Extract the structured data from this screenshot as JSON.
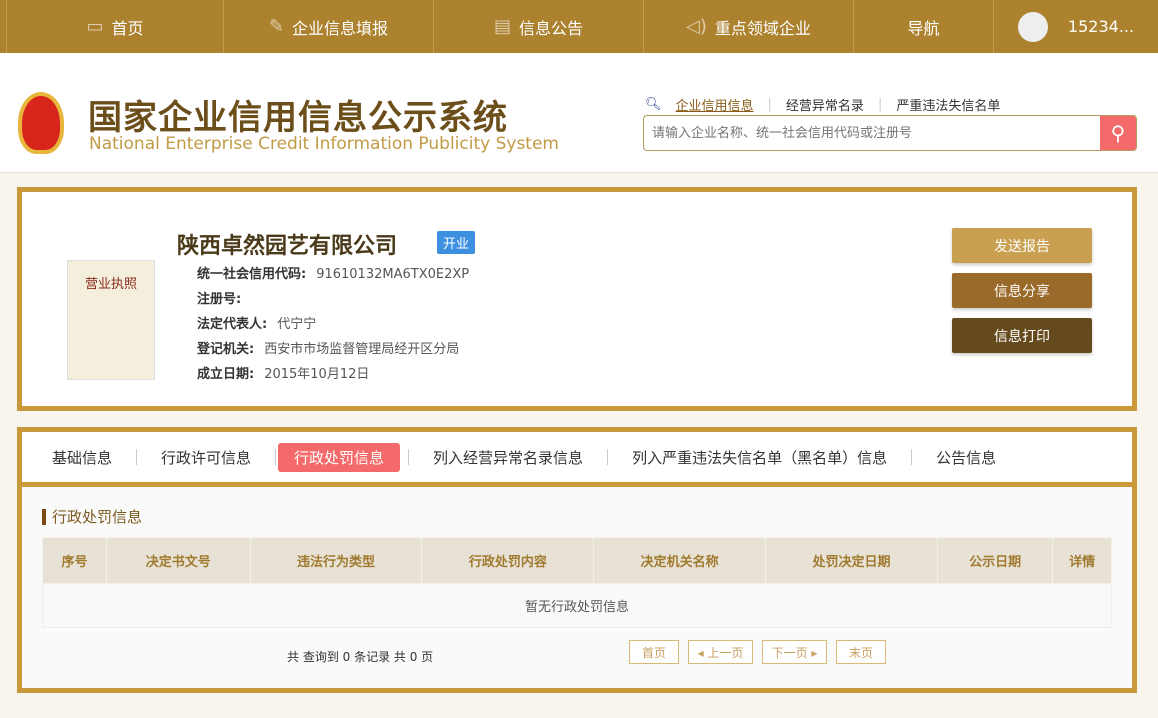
{
  "nav": {
    "items": [
      "首页",
      "企业信息填报",
      "信息公告",
      "重点领域企业",
      "导航"
    ],
    "user": "15234..."
  },
  "header": {
    "title": "国家企业信用信息公示系统",
    "subtitle": "National Enterprise Credit Information Publicity System",
    "links": [
      "企业信用信息",
      "经营异常名录",
      "严重违法失信名单"
    ],
    "search_placeholder": "请输入企业名称、统一社会信用代码或注册号"
  },
  "company": {
    "license_label": "营业执照",
    "name": "陕西卓然园艺有限公司",
    "status": "开业",
    "fields": [
      {
        "label": "统一社会信用代码:",
        "value": "91610132MA6TX0E2XP"
      },
      {
        "label": "注册号:",
        "value": ""
      },
      {
        "label": "法定代表人:",
        "value": "代宁宁"
      },
      {
        "label": "登记机关:",
        "value": "西安市市场监督管理局经开区分局"
      },
      {
        "label": "成立日期:",
        "value": "2015年10月12日"
      }
    ],
    "buttons": [
      "发送报告",
      "信息分享",
      "信息打印"
    ]
  },
  "tabs": [
    "基础信息",
    "行政许可信息",
    "行政处罚信息",
    "列入经营异常名录信息",
    "列入严重违法失信名单（黑名单）信息",
    "公告信息"
  ],
  "section": {
    "title": "行政处罚信息",
    "columns": [
      "序号",
      "决定书文号",
      "违法行为类型",
      "行政处罚内容",
      "决定机关名称",
      "处罚决定日期",
      "公示日期",
      "详情"
    ],
    "empty": "暂无行政处罚信息",
    "total": "共 查询到 0 条记录 共 0 页",
    "pager": [
      "首页",
      "◂ 上一页",
      "下一页 ▸",
      "末页"
    ]
  },
  "colors": {
    "nav": "#ad822f",
    "border": "#c9993a",
    "active_tab": "#f46a6a"
  }
}
